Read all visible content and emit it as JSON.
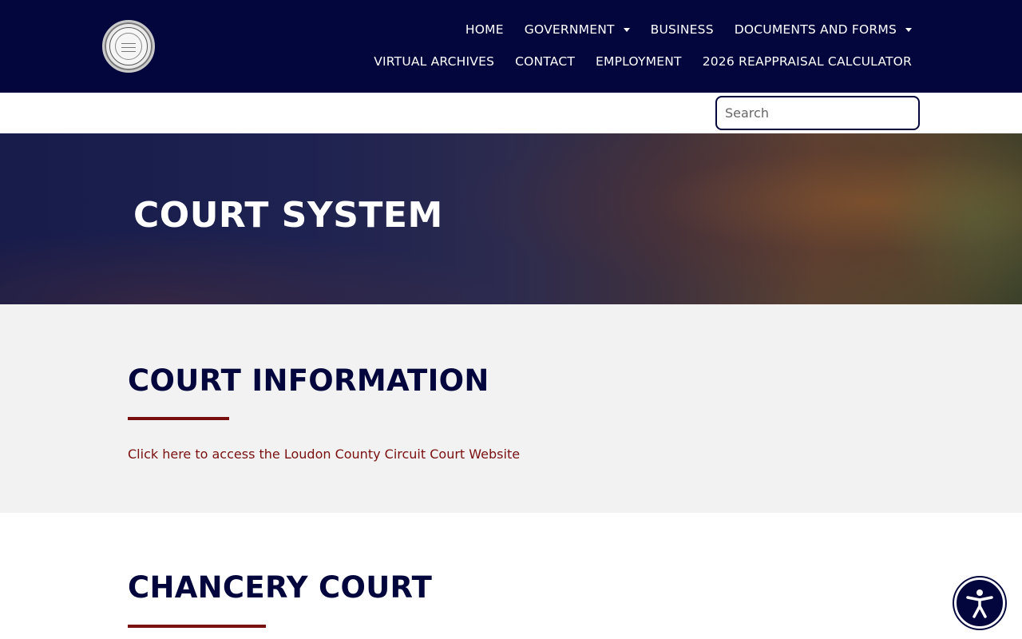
{
  "header": {
    "logo_icon": "county-seal-logo",
    "nav_row1": [
      {
        "label": "HOME",
        "has_dropdown": false
      },
      {
        "label": "GOVERNMENT",
        "has_dropdown": true
      },
      {
        "label": "BUSINESS",
        "has_dropdown": false
      },
      {
        "label": "DOCUMENTS AND FORMS",
        "has_dropdown": true
      }
    ],
    "nav_row2": [
      {
        "label": "VIRTUAL ARCHIVES",
        "has_dropdown": false
      },
      {
        "label": "CONTACT",
        "has_dropdown": false
      },
      {
        "label": "EMPLOYMENT",
        "has_dropdown": false
      },
      {
        "label": "2026 REAPPRAISAL CALCULATOR",
        "has_dropdown": false
      }
    ]
  },
  "search": {
    "placeholder": "Search",
    "value": ""
  },
  "hero": {
    "title": "COURT SYSTEM"
  },
  "court_information": {
    "heading": "COURT INFORMATION",
    "link_text": "Click here to access the Loudon County Circuit Court Website"
  },
  "chancery_court": {
    "heading": "CHANCERY COURT"
  },
  "accessibility": {
    "icon": "accessibility-icon"
  },
  "colors": {
    "header_bg": "#03063c",
    "accent_red": "#7a0f0f",
    "section_gray": "#f2f2f2"
  }
}
